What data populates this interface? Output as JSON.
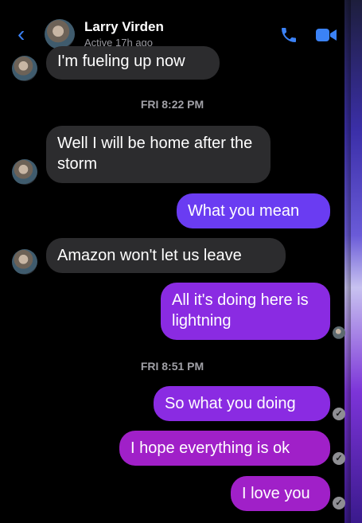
{
  "header": {
    "back_icon": "chevron-left-icon",
    "contact_name": "Larry Virden",
    "status": "Active 17h ago",
    "call_icon": "phone-icon",
    "video_icon": "video-camera-icon",
    "accent_color": "#3b82f6"
  },
  "messages": [
    {
      "type": "incoming",
      "text": "I'm fueling up now"
    },
    {
      "type": "timestamp",
      "text": "FRI 8:22 PM"
    },
    {
      "type": "incoming",
      "text": "Well I will be home after the storm"
    },
    {
      "type": "outgoing",
      "text": "What you mean"
    },
    {
      "type": "incoming",
      "text": "Amazon won't let us leave"
    },
    {
      "type": "outgoing",
      "text": "All it's doing here is lightning"
    },
    {
      "type": "timestamp",
      "text": "FRI 8:51 PM"
    },
    {
      "type": "outgoing",
      "text": "So what you doing"
    },
    {
      "type": "outgoing",
      "text": "I hope everything is ok"
    },
    {
      "type": "outgoing",
      "text": "I love you"
    }
  ],
  "colors": {
    "incoming_bubble": "#2c2c2e",
    "outgoing_blue": "#6a3cf2",
    "outgoing_purple": "#8a2be2",
    "outgoing_magenta": "#a020c8",
    "background": "#000000"
  }
}
